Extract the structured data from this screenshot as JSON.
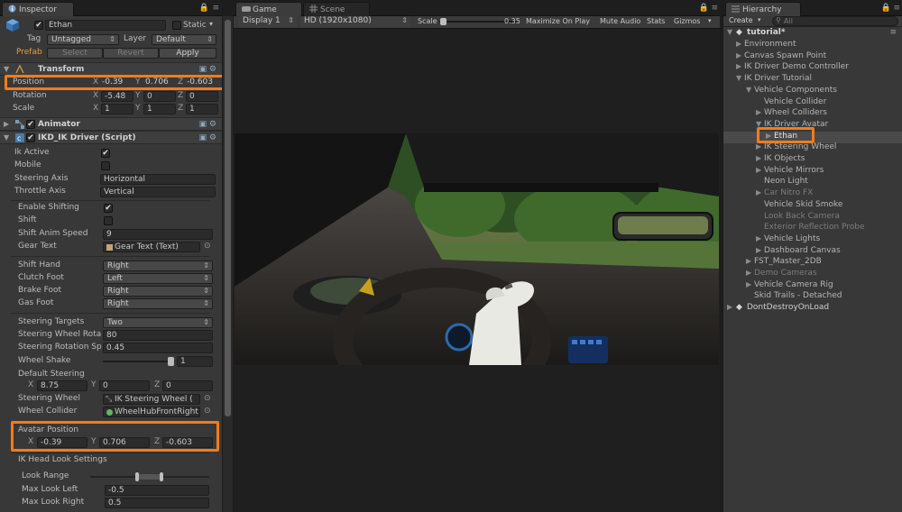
{
  "inspector": {
    "tab_label": "Inspector",
    "object_name": "Ethan",
    "static_label": "Static",
    "tag_label": "Tag",
    "tag_value": "Untagged",
    "layer_label": "Layer",
    "layer_value": "Default",
    "prefab_label": "Prefab",
    "prefab_buttons": [
      "Select",
      "Revert",
      "Apply"
    ],
    "transform": {
      "title": "Transform",
      "rows": [
        {
          "label": "Position",
          "x": "-0.39",
          "y": "0.706",
          "z": "-0.603"
        },
        {
          "label": "Rotation",
          "x": "-5.48",
          "y": "0",
          "z": "0"
        },
        {
          "label": "Scale",
          "x": "1",
          "y": "1",
          "z": "1"
        }
      ]
    },
    "animator_title": "Animator",
    "ikd_title": "IKD_IK Driver (Script)",
    "ikd": {
      "ik_active_label": "Ik Active",
      "mobile_label": "Mobile",
      "steering_axis_label": "Steering Axis",
      "steering_axis_value": "Horizontal",
      "throttle_axis_label": "Throttle Axis",
      "throttle_axis_value": "Vertical",
      "enable_shifting_label": "Enable Shifting",
      "shift_label": "Shift",
      "shift_anim_speed_label": "Shift Anim Speed",
      "shift_anim_speed_value": "9",
      "gear_text_label": "Gear Text",
      "gear_text_value": "Gear Text (Text)",
      "shift_hand_label": "Shift Hand",
      "shift_hand_value": "Right",
      "clutch_foot_label": "Clutch Foot",
      "clutch_foot_value": "Left",
      "brake_foot_label": "Brake Foot",
      "brake_foot_value": "Right",
      "gas_foot_label": "Gas Foot",
      "gas_foot_value": "Right",
      "steering_targets_label": "Steering Targets",
      "steering_targets_value": "Two",
      "steering_wheel_rota_label": "Steering Wheel Rota",
      "steering_wheel_rota_value": "80",
      "steering_rotation_sp_label": "Steering Rotation Sp",
      "steering_rotation_sp_value": "0.45",
      "wheel_shake_label": "Wheel Shake",
      "wheel_shake_value": "1",
      "default_steering_label": "Default Steering",
      "default_steering": {
        "x": "8.75",
        "y": "0",
        "z": "0"
      },
      "steering_wheel_label": "Steering Wheel",
      "steering_wheel_value": "IK Steering Wheel (",
      "wheel_collider_label": "Wheel Collider",
      "wheel_collider_value": "WheelHubFrontRight",
      "avatar_position_label": "Avatar Position",
      "avatar_position": {
        "x": "-0.39",
        "y": "0.706",
        "z": "-0.603"
      },
      "ik_head_look_label": "IK Head Look Settings",
      "look_range_label": "Look Range",
      "max_look_left_label": "Max Look Left",
      "max_look_left_value": "-0.5",
      "max_look_right_label": "Max Look Right",
      "max_look_right_value": "0.5"
    }
  },
  "game": {
    "tabs": [
      "Game",
      "Scene"
    ],
    "display_value": "Display 1",
    "resolution_value": "HD (1920x1080)",
    "scale_label": "Scale",
    "scale_value": "0.35",
    "toolbar_buttons": [
      "Maximize On Play",
      "Mute Audio",
      "Stats",
      "Gizmos"
    ]
  },
  "hierarchy": {
    "tab_label": "Hierarchy",
    "create_label": "Create",
    "search_placeholder": "All",
    "scene_name": "tutorial*",
    "items": [
      {
        "label": "Environment",
        "depth": 1,
        "arrow": "right",
        "dim": false
      },
      {
        "label": "Canvas Spawn Point",
        "depth": 1,
        "arrow": "right",
        "dim": false
      },
      {
        "label": "IK Driver Demo Controller",
        "depth": 1,
        "arrow": "right",
        "dim": false
      },
      {
        "label": "IK Driver Tutorial",
        "depth": 1,
        "arrow": "down",
        "dim": false
      },
      {
        "label": "Vehicle Components",
        "depth": 2,
        "arrow": "down",
        "dim": false
      },
      {
        "label": "Vehicle Collider",
        "depth": 3,
        "arrow": "none",
        "dim": false
      },
      {
        "label": "Wheel Colliders",
        "depth": 3,
        "arrow": "right",
        "dim": false
      },
      {
        "label": "IK Driver Avatar",
        "depth": 3,
        "arrow": "down",
        "dim": false
      },
      {
        "label": "Ethan",
        "depth": 4,
        "arrow": "right",
        "dim": false,
        "selected": true
      },
      {
        "label": "IK Steering Wheel",
        "depth": 3,
        "arrow": "right",
        "dim": false
      },
      {
        "label": "IK Objects",
        "depth": 3,
        "arrow": "right",
        "dim": false
      },
      {
        "label": "Vehicle Mirrors",
        "depth": 3,
        "arrow": "right",
        "dim": false
      },
      {
        "label": "Neon Light",
        "depth": 3,
        "arrow": "none",
        "dim": false
      },
      {
        "label": "Car Nitro FX",
        "depth": 3,
        "arrow": "right",
        "dim": true
      },
      {
        "label": "Vehicle Skid Smoke",
        "depth": 3,
        "arrow": "none",
        "dim": false
      },
      {
        "label": "Look Back Camera",
        "depth": 3,
        "arrow": "none",
        "dim": true
      },
      {
        "label": "Exterior Reflection Probe",
        "depth": 3,
        "arrow": "none",
        "dim": true
      },
      {
        "label": "Vehicle Lights",
        "depth": 3,
        "arrow": "right",
        "dim": false
      },
      {
        "label": "Dashboard Canvas",
        "depth": 3,
        "arrow": "right",
        "dim": false
      },
      {
        "label": "FST_Master_2DB",
        "depth": 2,
        "arrow": "right",
        "dim": false
      },
      {
        "label": "Demo Cameras",
        "depth": 2,
        "arrow": "right",
        "dim": true
      },
      {
        "label": "Vehicle Camera Rig",
        "depth": 2,
        "arrow": "right",
        "dim": false
      },
      {
        "label": "Skid Trails - Detached",
        "depth": 2,
        "arrow": "none",
        "dim": false
      }
    ],
    "dontdestroy_label": "DontDestroyOnLoad"
  },
  "colors": {
    "highlight": "#f07c1e",
    "panel": "#383838",
    "selected_row": "#3d5a80"
  }
}
